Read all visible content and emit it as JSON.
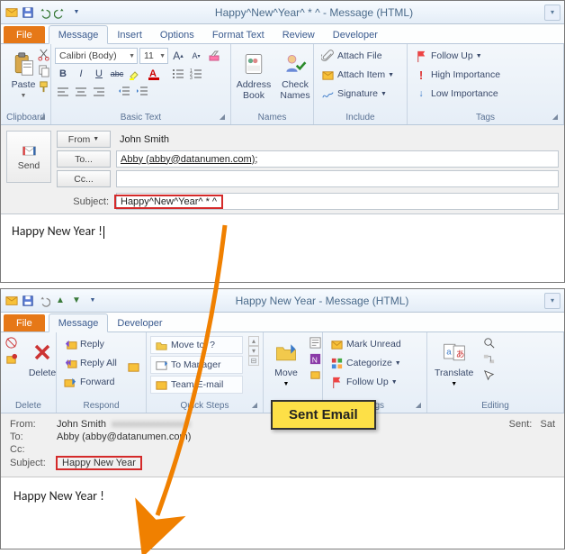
{
  "top": {
    "title": "Happy^New^Year^ * ^    - Message (HTML)",
    "tabs": {
      "file": "File",
      "message": "Message",
      "insert": "Insert",
      "options": "Options",
      "format": "Format Text",
      "review": "Review",
      "developer": "Developer"
    },
    "ribbon": {
      "clipboard": {
        "label": "Clipboard",
        "paste": "Paste"
      },
      "basictext": {
        "label": "Basic Text",
        "font": "Calibri (Body)",
        "size": "11",
        "bold": "B",
        "italic": "I",
        "underline": "U",
        "strike": "abc",
        "A1": "A",
        "A2": "A"
      },
      "names": {
        "label": "Names",
        "addrbook": "Address\nBook",
        "checknames": "Check\nNames"
      },
      "include": {
        "label": "Include",
        "attachfile": "Attach File",
        "attachitem": "Attach Item",
        "signature": "Signature"
      },
      "tags": {
        "label": "Tags",
        "followup": "Follow Up",
        "high": "High Importance",
        "low": "Low Importance"
      }
    },
    "compose": {
      "send": "Send",
      "from_btn": "From",
      "from_val": "John Smith",
      "to_btn": "To...",
      "to_val": "Abby (abby@datanumen.com);",
      "cc_btn": "Cc...",
      "subject_lbl": "Subject:",
      "subject_val": "Happy^New^Year^ * ^",
      "body": "Happy New Year !"
    }
  },
  "bottom": {
    "title": "Happy New Year    - Message (HTML)",
    "tabs": {
      "file": "File",
      "message": "Message",
      "developer": "Developer"
    },
    "ribbon": {
      "delete": {
        "label": "Delete",
        "delete": "Delete"
      },
      "respond": {
        "label": "Respond",
        "reply": "Reply",
        "replyall": "Reply All",
        "forward": "Forward"
      },
      "quicksteps": {
        "label": "Quick Steps",
        "moveto": "Move to: ?",
        "tomanager": "To Manager",
        "teamemail": "Team E-mail"
      },
      "move": {
        "label": "Move",
        "move": "Move"
      },
      "tags": {
        "label": "Tags",
        "markunread": "Mark Unread",
        "categorize": "Categorize",
        "followup": "Follow Up"
      },
      "editing": {
        "label": "Editing",
        "translate": "Translate"
      }
    },
    "header": {
      "from_lbl": "From:",
      "from_val": "John Smith",
      "to_lbl": "To:",
      "to_val": "Abby (abby@datanumen.com)",
      "cc_lbl": "Cc:",
      "subject_lbl": "Subject:",
      "subject_val": "Happy New Year",
      "sent_lbl": "Sent:",
      "sent_val": "Sat",
      "body": "Happy New Year !"
    }
  },
  "annotation": {
    "sent_email": "Sent Email"
  }
}
